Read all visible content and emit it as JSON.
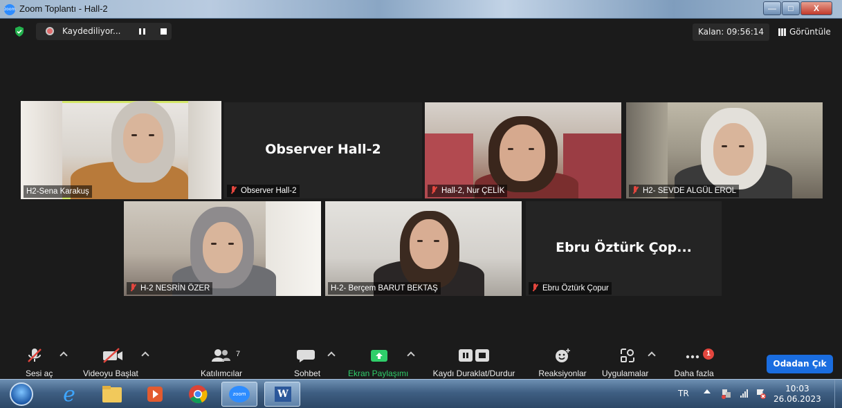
{
  "window": {
    "title": "Zoom Toplantı - Hall-2",
    "app_icon_text": "zoom",
    "minimize": "—",
    "maximize": "□",
    "close": "X"
  },
  "top_bar": {
    "recording_label": "Kaydediliyor...",
    "timer": "Kalan: 09:56:14",
    "view_label": "Görüntüle"
  },
  "tiles": [
    {
      "name": "H2-Sena Karakuş",
      "muted": false,
      "active": true,
      "video": true
    },
    {
      "name": "Observer Hall-2",
      "center_name": "Observer Hall-2",
      "muted": true,
      "video": false
    },
    {
      "name": "Hall-2, Nur ÇELİK",
      "muted": true,
      "video": true
    },
    {
      "name": "H2- SEVDE ALGÜL EROL",
      "muted": true,
      "video": true
    },
    {
      "name": "H-2 NESRİN ÖZER",
      "muted": true,
      "video": true
    },
    {
      "name": "H-2- Berçem BARUT BEKTAŞ",
      "muted": false,
      "video": true
    },
    {
      "name": "Ebru Öztürk Çopur",
      "center_name": "Ebru Öztürk Çop...",
      "muted": true,
      "video": false
    }
  ],
  "toolbar": {
    "audio": "Sesi aç",
    "video": "Videoyu Başlat",
    "participants": "Katılımcılar",
    "participants_count": "7",
    "chat": "Sohbet",
    "share": "Ekran Paylaşımı",
    "record": "Kaydı Duraklat/Durdur",
    "reactions": "Reaksiyonlar",
    "apps": "Uygulamalar",
    "more": "Daha fazla",
    "more_badge": "1",
    "leave": "Odadan Çık",
    "share_color": "#2fce6a",
    "leave_color": "#1a6de0"
  },
  "taskbar": {
    "apps": [
      "start-orb-icon",
      "internet-explorer-icon",
      "file-explorer-icon",
      "media-player-icon",
      "chrome-icon",
      "zoom-icon",
      "word-icon"
    ],
    "zoom_label": "zoom",
    "word_label": "W",
    "language": "TR",
    "time": "10:03",
    "date": "26.06.2023"
  }
}
